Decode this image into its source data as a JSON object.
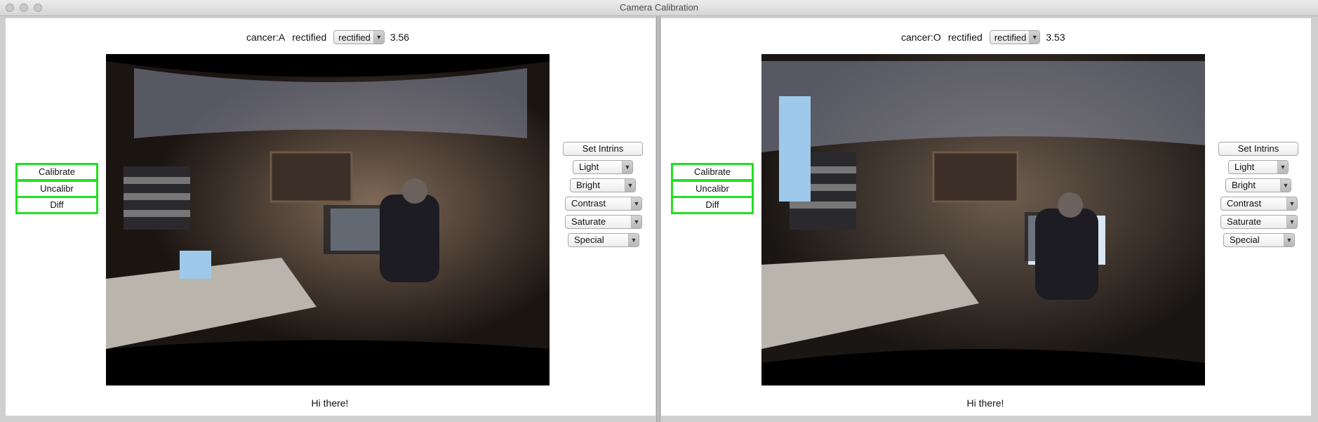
{
  "window": {
    "title": "Camera Calibration"
  },
  "panes": [
    {
      "camera": "cancer:A",
      "mode_label": "rectified",
      "mode_select": "rectified",
      "score": "3.56",
      "left_buttons": [
        "Calibrate",
        "Uncalibr",
        "Diff"
      ],
      "set_intrins": "Set Intrins",
      "dropdowns": [
        "Light",
        "Bright",
        "Contrast",
        "Saturate",
        "Special"
      ],
      "footer": "Hi there!"
    },
    {
      "camera": "cancer:O",
      "mode_label": "rectified",
      "mode_select": "rectified",
      "score": "3.53",
      "left_buttons": [
        "Calibrate",
        "Uncalibr",
        "Diff"
      ],
      "set_intrins": "Set Intrins",
      "dropdowns": [
        "Light",
        "Bright",
        "Contrast",
        "Saturate",
        "Special"
      ],
      "footer": "Hi there!"
    }
  ],
  "colors": {
    "highlight_border": "#22e022"
  },
  "icons": {
    "dropdown": "chevron-down-icon"
  }
}
